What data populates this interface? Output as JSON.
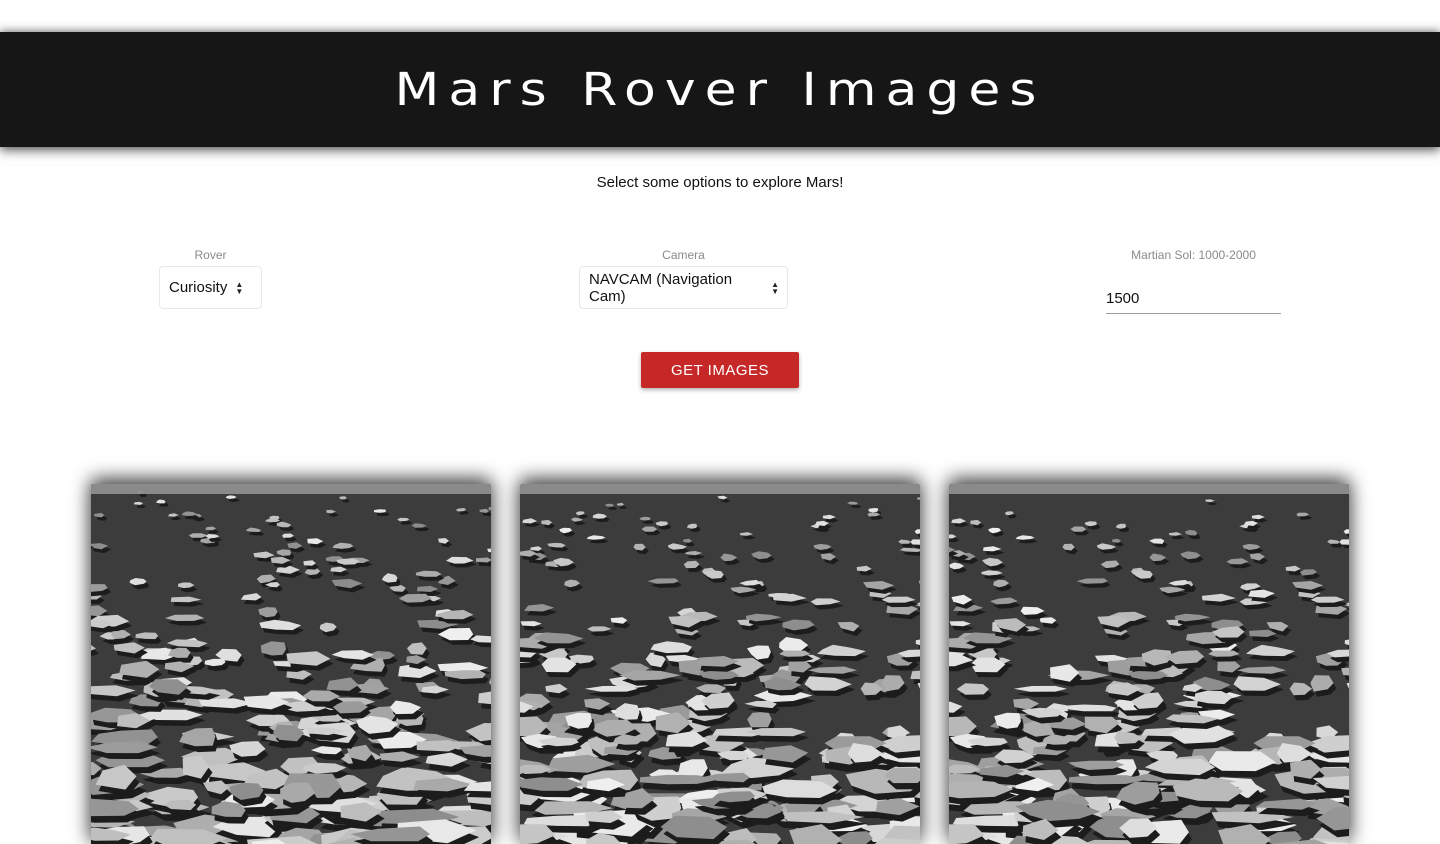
{
  "header": {
    "title": "Mars Rover Images"
  },
  "intro": {
    "text": "Select some options to explore Mars!"
  },
  "filters": {
    "rover": {
      "label": "Rover",
      "selected": "Curiosity"
    },
    "camera": {
      "label": "Camera",
      "selected": "NAVCAM (Navigation Cam)"
    },
    "sol": {
      "label": "Martian Sol: 1000-2000",
      "value": "1500"
    }
  },
  "actions": {
    "get_images_label": "GET IMAGES"
  },
  "colors": {
    "header_bg": "#161616",
    "button_bg": "#c62828",
    "label_text": "#8a8a8a"
  },
  "gallery": {
    "images": [
      {
        "subject": "mars-rocky-terrain"
      },
      {
        "subject": "mars-rocky-terrain"
      },
      {
        "subject": "mars-rocky-terrain"
      }
    ]
  }
}
